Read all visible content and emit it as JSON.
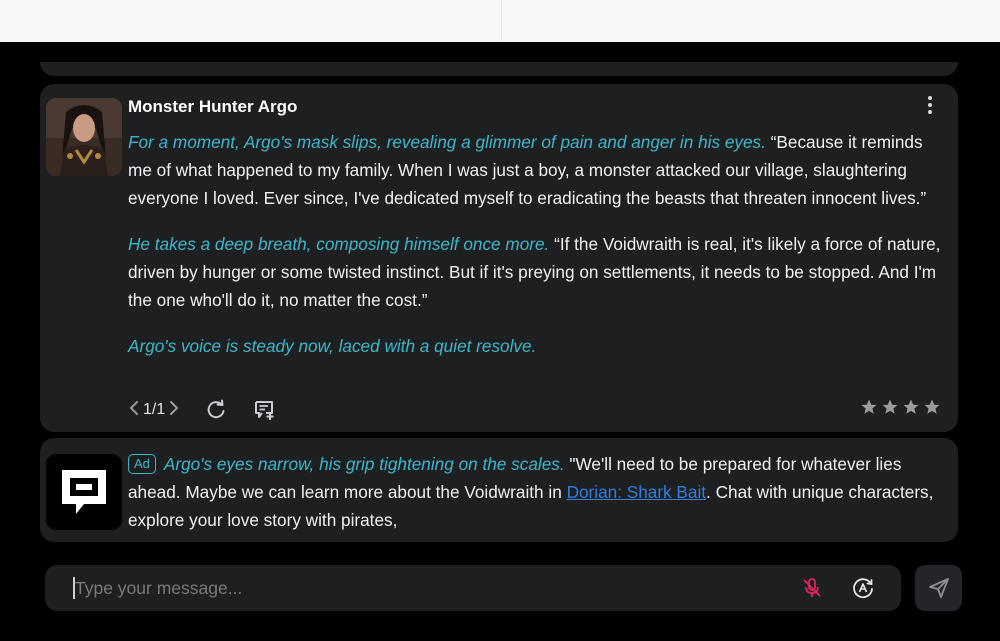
{
  "character": {
    "name": "Monster Hunter Argo"
  },
  "message": {
    "paragraphs": [
      {
        "action": "For a moment, Argo's mask slips, revealing a glimmer of pain and anger in his eyes.",
        "speech": " “Because it reminds me of what happened to my family. When I was just a boy, a monster attacked our village, slaughtering everyone I loved. Ever since, I've dedicated myself to eradicating the beasts that threaten innocent lives.”"
      },
      {
        "action": "He takes a deep breath, composing himself once more.",
        "speech": " “If the Voidwraith is real, it's likely a force of nature, driven by hunger or some twisted instinct. But if it's preying on settlements, it needs to be stopped. And I'm the one who'll do it, no matter the cost.”"
      },
      {
        "action": "Argo's voice is steady now, laced with a quiet resolve.",
        "speech": ""
      }
    ],
    "pager": "1/1",
    "rating_stars": 4
  },
  "ad": {
    "badge": "Ad",
    "action": "Argo's eyes narrow, his grip tightening on the scales.",
    "text_before_link": " \"We'll need to be prepared for whatever lies ahead. Maybe we can learn more about the Voidwraith in ",
    "link": "Dorian: Shark Bait",
    "text_after_link": ". Chat with unique characters, explore your love story with pirates,"
  },
  "composer": {
    "placeholder": "Type your message..."
  },
  "icons": {
    "menu": "more-vertical-icon",
    "prev": "chevron-left-icon",
    "next": "chevron-right-icon",
    "regenerate": "refresh-icon",
    "feedback": "comment-plus-icon",
    "star": "star-icon",
    "mic": "mic-off-icon",
    "auto": "auto-icon",
    "send": "send-icon",
    "ad_logo": "chat-bubble-logo-icon"
  },
  "colors": {
    "accent": "#3fb6c9",
    "link": "#2f7fe0",
    "mic_off": "#e0245e",
    "card": "#1e1f21"
  }
}
